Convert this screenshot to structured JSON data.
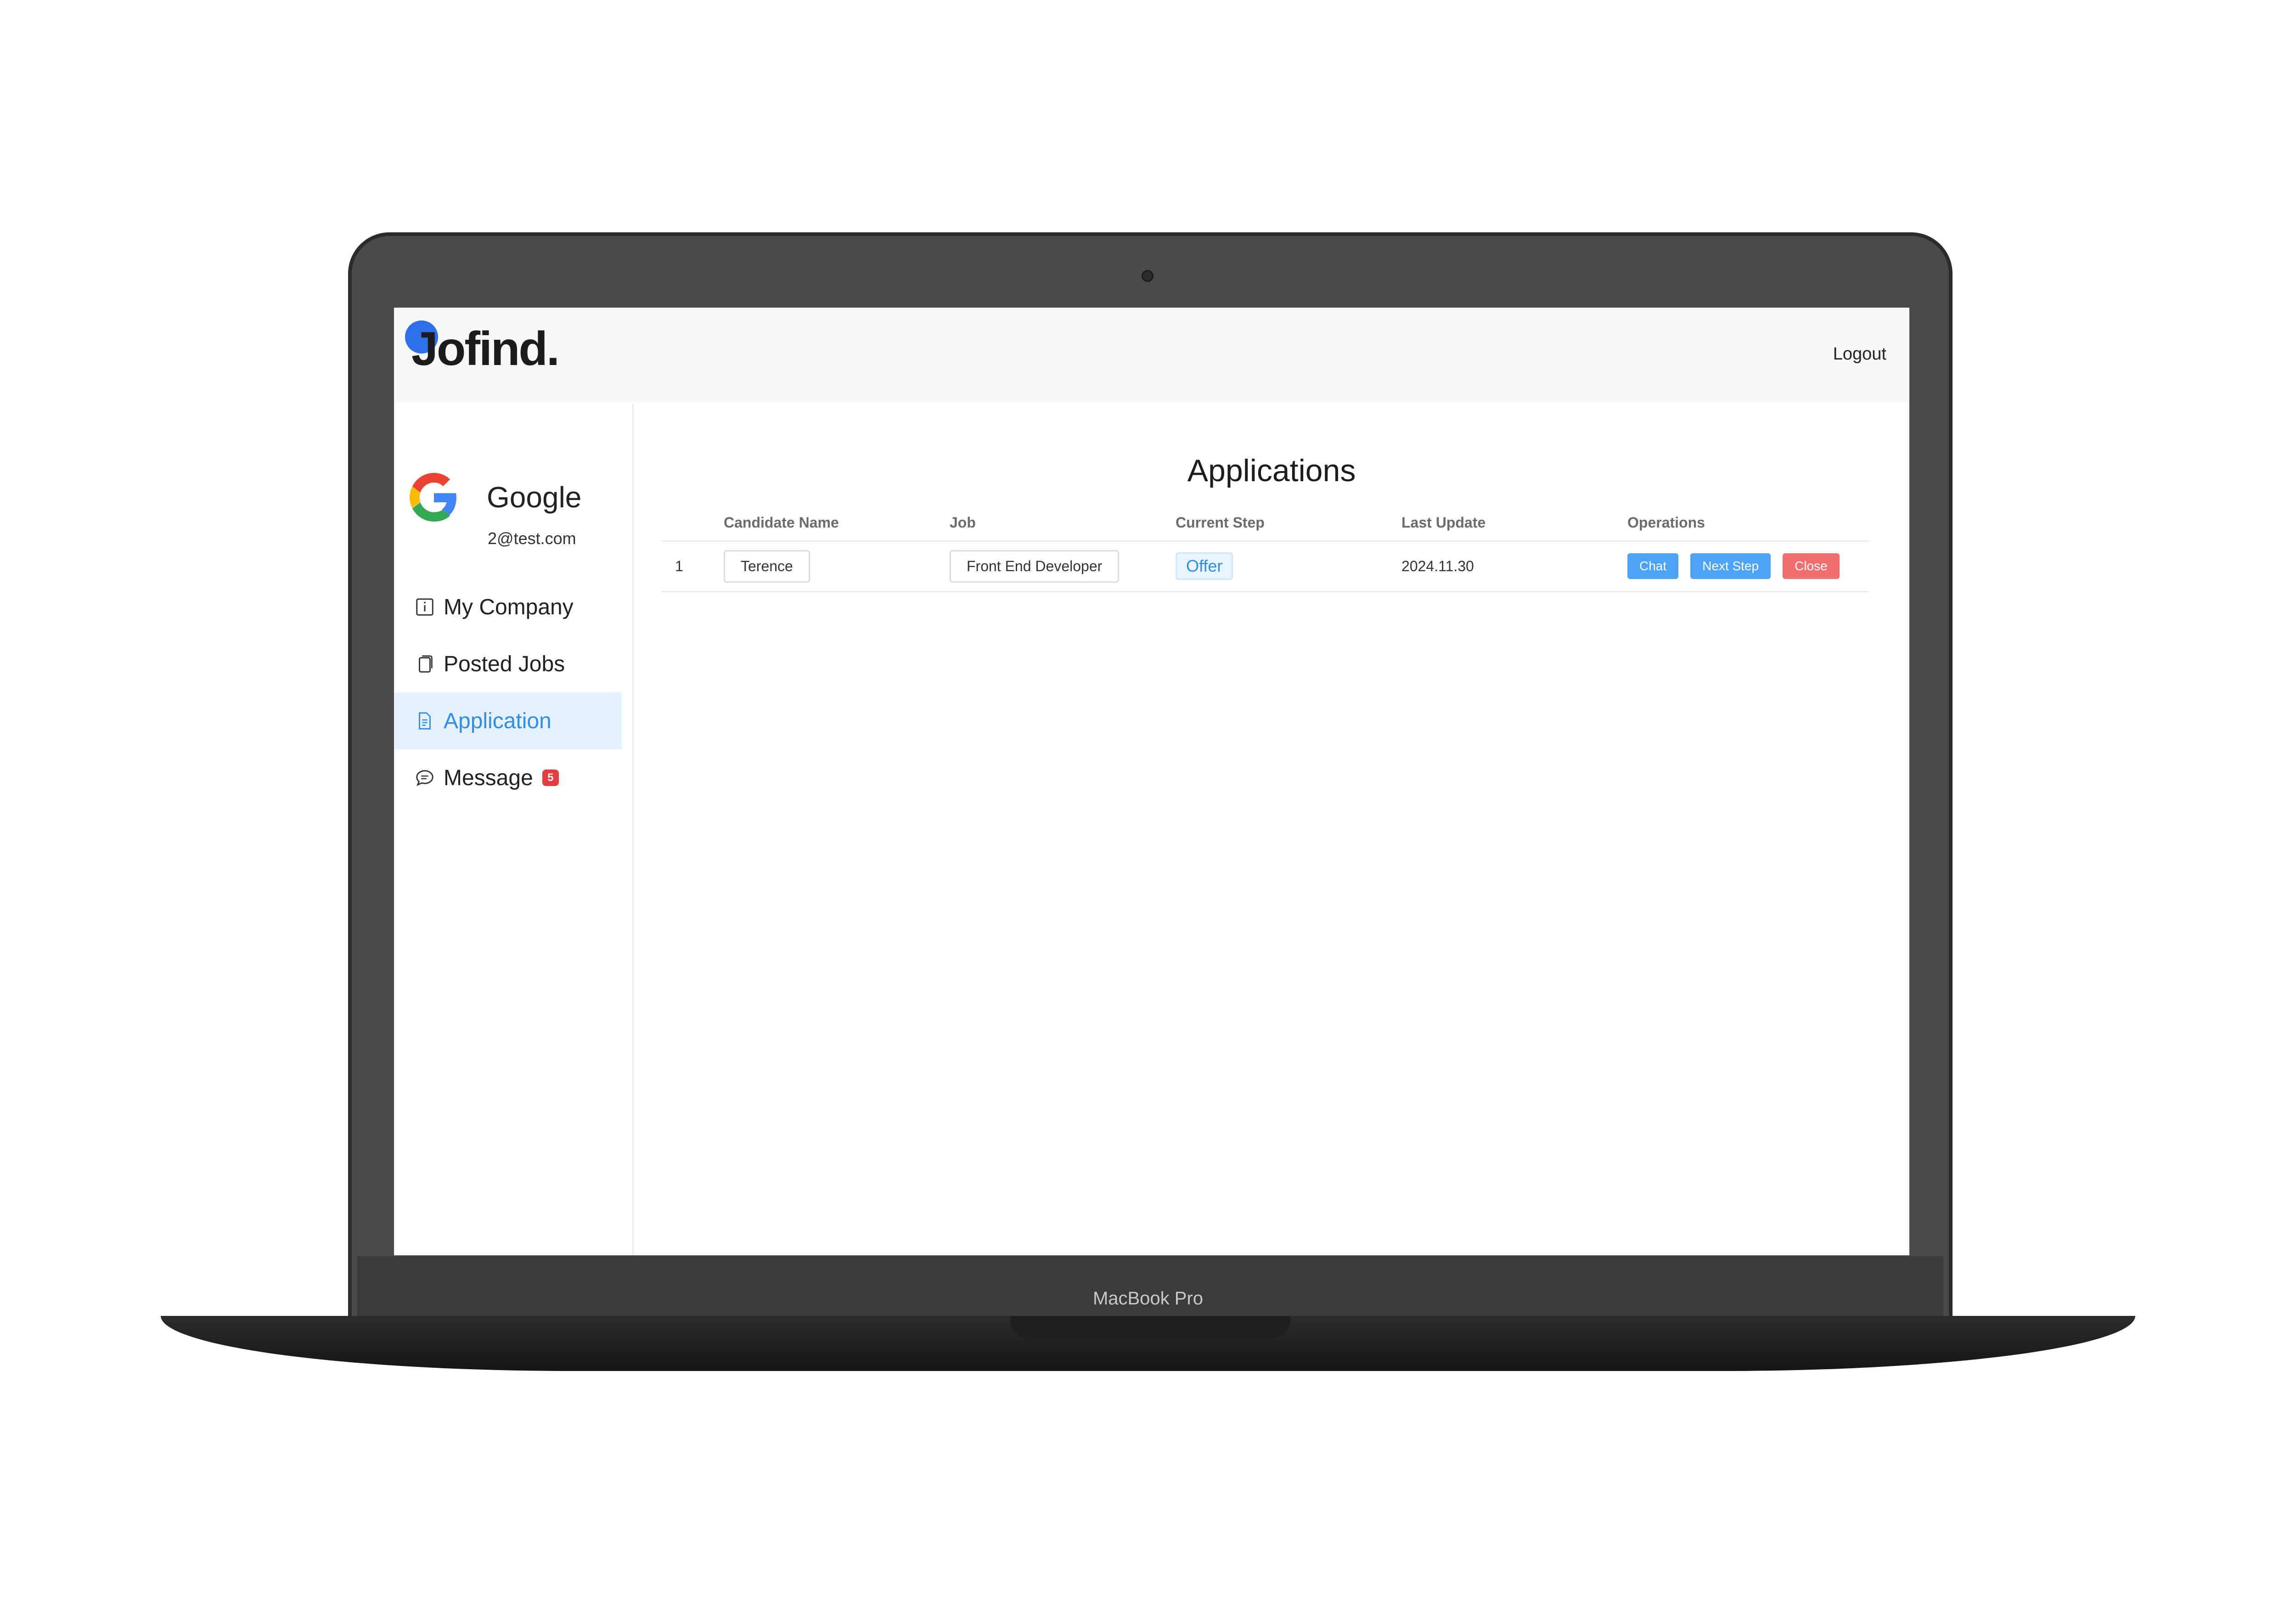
{
  "device": {
    "label": "MacBook Pro"
  },
  "header": {
    "logo_text": "Jofind.",
    "logout_label": "Logout"
  },
  "sidebar": {
    "company_name": "Google",
    "company_email": "2@test.com",
    "company_logo_icon": "google-g-icon",
    "items": [
      {
        "label": "My Company",
        "icon": "info-icon",
        "active": false
      },
      {
        "label": "Posted Jobs",
        "icon": "copy-icon",
        "active": false
      },
      {
        "label": "Application",
        "icon": "file-text-icon",
        "active": true
      },
      {
        "label": "Message",
        "icon": "chat-bubble-icon",
        "active": false,
        "badge": "5"
      }
    ]
  },
  "main": {
    "title": "Applications",
    "columns": [
      "",
      "Candidate Name",
      "Job",
      "Current Step",
      "Last Update",
      "Operations"
    ],
    "rows": [
      {
        "index": "1",
        "candidate": "Terence",
        "job": "Front End Developer",
        "step": "Offer",
        "updated": "2024.11.30",
        "actions": {
          "chat": "Chat",
          "next": "Next Step",
          "close": "Close"
        }
      }
    ]
  },
  "colors": {
    "accent": "#4da3f5",
    "danger": "#f06e6e",
    "active_bg": "#e6f1fd",
    "logo_dot": "#2f6fe8",
    "badge": "#e23d3d"
  }
}
